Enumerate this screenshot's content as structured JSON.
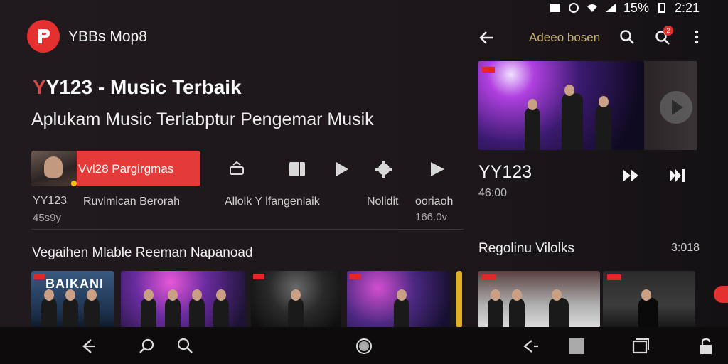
{
  "status_bar": {
    "battery": "15%",
    "time": "2:21"
  },
  "app": {
    "name": "YBBs Mop8",
    "title_prefix": "Y",
    "title": "Y123 - Music Terbaik",
    "subtitle": "Aplukam Music Terlabptur Pengemar Musik"
  },
  "promo": {
    "label": "Vvl28 Pargirgmas"
  },
  "left_meta": {
    "item1_title": "YY123",
    "item1_dur": "45s9y",
    "item2_title": "Ruvimican Berorah",
    "item3_title": "Allolk Y lfangenlaik",
    "item4_title": "Nolidit",
    "item5_title": "ooriaoh",
    "item5_dur": "166.0v"
  },
  "left_section": {
    "title": "Vegaihen Mlable Reeman Napanoad"
  },
  "cards": [
    {
      "text": "BAIKANI"
    },
    {
      "text": ""
    },
    {
      "text": ""
    },
    {
      "text": ""
    }
  ],
  "right_panel": {
    "header_title": "Adeeo bosen",
    "notification_count": "2",
    "now_playing_title": "YY123",
    "now_playing_duration": "46:00",
    "section_title": "Regolinu Vilolks",
    "section_count": "3:018"
  },
  "colors": {
    "accent": "#e53030",
    "background": "#1d171b",
    "navbar": "#0d0b0c"
  }
}
